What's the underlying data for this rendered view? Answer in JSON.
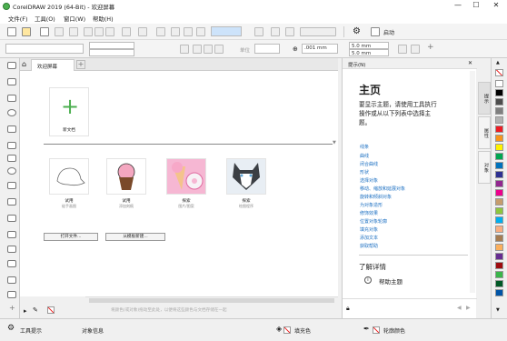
{
  "window": {
    "title": "CorelDRAW 2019 (64-Bit) - 欢迎屏幕",
    "min": "—",
    "max": "☐",
    "close": "✕"
  },
  "menu": [
    "文件(F)",
    "工具(O)",
    "窗口(W)",
    "帮助(H)"
  ],
  "toolbar1": {
    "zoom_value": "",
    "launch_label": "启动"
  },
  "toolbar2": {
    "nudge": ".001 mm",
    "w": "5.0 mm",
    "h": "5.0 mm",
    "unit_label": "单位"
  },
  "tab": {
    "label": "欢迎屏幕",
    "add": "+"
  },
  "welcome": {
    "new_doc_label": "新文档",
    "templates": [
      {
        "title": "试用",
        "sub": "徒手画图",
        "color": "#777"
      },
      {
        "title": "试用",
        "sub": "添加刻痕",
        "color": "#f4a7c0"
      },
      {
        "title": "探索",
        "sub": "图片/图案",
        "color": "#f29cc4"
      },
      {
        "title": "探索",
        "sub": "绘图程序",
        "color": "#5fa7d8"
      }
    ],
    "open_file_btn": "打开文件...",
    "open_template_btn": "从模板新建...",
    "hint": "将颜色(或对象)拖动至此处，以便将这些颜色与文档存储在一起"
  },
  "docker": {
    "header": "提示(N)",
    "title": "主页",
    "desc": "要显示主题，请使用工具执行操作或从以下列表中选择主题。",
    "links": [
      "线条",
      "曲线",
      "闭合曲线",
      "形状",
      "选择对象",
      "移动、缩放和延展对象",
      "旋转和倾斜对象",
      "为对象造形",
      "修饰效果",
      "位置对象轮廓",
      "填充对象",
      "添加文本",
      "获取帮助"
    ],
    "learn_more": "了解详情",
    "help_topics": "帮助主题"
  },
  "vtabs": [
    "提示",
    "属性",
    "对象"
  ],
  "palette_colors": [
    "#ffffff",
    "#000000",
    "#4d4d4d",
    "#7f7f7f",
    "#b2b2b2",
    "#ed1c24",
    "#f7941d",
    "#fff200",
    "#00a651",
    "#0072bc",
    "#2e3192",
    "#92278f",
    "#ec008c",
    "#c69c6d",
    "#8dc63f",
    "#00aeef",
    "#f9ad81",
    "#a67c52",
    "#fbaf5d",
    "#662d91",
    "#9e0b0f",
    "#39b54a",
    "#005826",
    "#0054a6"
  ],
  "status": {
    "tool_hint": "工具提示",
    "object_info": "对象信息",
    "fill_label": "填充色",
    "outline_label": "轮廓颜色"
  }
}
